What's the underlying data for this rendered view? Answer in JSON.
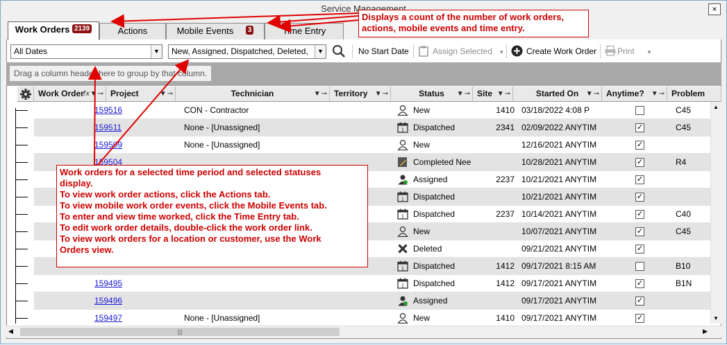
{
  "window": {
    "title": "Service Management",
    "close_label": "×"
  },
  "tabs": [
    {
      "label": "Work Orders",
      "badge": "2139"
    },
    {
      "label": "Actions",
      "badge": ""
    },
    {
      "label": "Mobile Events",
      "badge": "3"
    },
    {
      "label": "Time Entry",
      "badge": ""
    }
  ],
  "toolbar": {
    "date_filter": "All Dates",
    "status_filter": "New, Assigned, Dispatched, Deleted,",
    "no_start_date": "No Start Date",
    "assign_selected": "Assign Selected",
    "create_work_order": "Create Work Order",
    "print": "Print"
  },
  "group_panel": {
    "hint": "Drag a column header here to group by that column."
  },
  "columns": {
    "work_order": "Work Order",
    "project": "Project",
    "technician": "Technician",
    "territory": "Territory",
    "status": "Status",
    "site": "Site",
    "started_on": "Started On",
    "anytime": "Anytime?",
    "problem": "Problem"
  },
  "rows": [
    {
      "wo": "159516",
      "tech": "CON - Contractor",
      "status": "New",
      "icon": "person-outline-icon",
      "site": "1410",
      "started": "03/18/2022  4:08 P",
      "anytime": false,
      "problem": "C45"
    },
    {
      "wo": "159511",
      "tech": "None - [Unassigned]",
      "status": "Dispatched",
      "icon": "calendar-icon",
      "site": "2341",
      "started": "02/09/2022 ANYTIM",
      "anytime": true,
      "problem": "C45"
    },
    {
      "wo": "159509",
      "tech": "None - [Unassigned]",
      "status": "New",
      "icon": "person-outline-icon",
      "site": "",
      "started": "12/16/2021 ANYTIM",
      "anytime": true,
      "problem": ""
    },
    {
      "wo": "159504",
      "tech": "",
      "status": "Completed Nee",
      "icon": "pencil-icon",
      "site": "",
      "started": "10/28/2021 ANYTIM",
      "anytime": true,
      "problem": "R4"
    },
    {
      "wo": "",
      "tech": "",
      "status": "Assigned",
      "icon": "person-assigned-icon",
      "site": "2237",
      "started": "10/21/2021 ANYTIM",
      "anytime": true,
      "problem": ""
    },
    {
      "wo": "",
      "tech": "",
      "status": "Dispatched",
      "icon": "calendar-icon",
      "site": "",
      "started": "10/21/2021 ANYTIM",
      "anytime": true,
      "problem": ""
    },
    {
      "wo": "",
      "tech": "",
      "status": "Dispatched",
      "icon": "calendar-icon",
      "site": "2237",
      "started": "10/14/2021 ANYTIM",
      "anytime": true,
      "problem": "C40"
    },
    {
      "wo": "",
      "tech": "",
      "status": "New",
      "icon": "person-outline-icon",
      "site": "",
      "started": "10/07/2021 ANYTIM",
      "anytime": true,
      "problem": "C45"
    },
    {
      "wo": "",
      "tech": "",
      "status": "Deleted",
      "icon": "x-icon",
      "site": "",
      "started": "09/21/2021 ANYTIM",
      "anytime": true,
      "problem": ""
    },
    {
      "wo": "",
      "tech": "",
      "status": "Dispatched",
      "icon": "calendar-icon",
      "site": "1412",
      "started": "09/17/2021  8:15 AM",
      "anytime": false,
      "problem": "B10"
    },
    {
      "wo": "159495",
      "tech": "",
      "status": "Dispatched",
      "icon": "calendar-icon",
      "site": "1412",
      "started": "09/17/2021 ANYTIM",
      "anytime": true,
      "problem": "B1N"
    },
    {
      "wo": "159496",
      "tech": "",
      "status": "Assigned",
      "icon": "person-assigned-icon",
      "site": "",
      "started": "09/17/2021 ANYTIM",
      "anytime": true,
      "problem": ""
    },
    {
      "wo": "159497",
      "tech": "None - [Unassigned]",
      "status": "New",
      "icon": "person-outline-icon",
      "site": "1410",
      "started": "09/17/2021 ANYTIM",
      "anytime": true,
      "problem": ""
    }
  ],
  "callouts": {
    "top": [
      "Displays a count of the number of work orders,",
      "actions, mobile events and time entry."
    ],
    "bottom": [
      "Work orders for a selected time period and selected statuses",
      "display.",
      "To view work order actions, click the Actions tab.",
      "To view mobile work order events, click the Mobile Events tab.",
      "To enter and view time worked, click the Time Entry tab.",
      "To edit work order details, double-click the work order link.",
      "To view work orders for a location or customer, use the Work",
      "Orders view."
    ]
  },
  "colors": {
    "callout": "#cc0000",
    "badge": "#8b1010",
    "link": "#1a1ad6"
  }
}
